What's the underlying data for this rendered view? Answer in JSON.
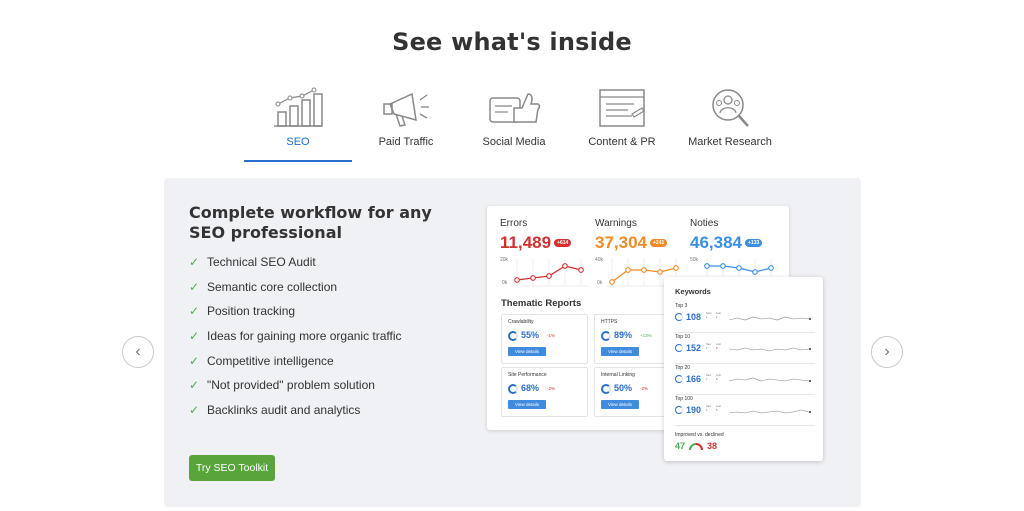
{
  "page": {
    "title": "See what's inside"
  },
  "tabs": [
    {
      "label": "SEO",
      "icon": "bar-chart-icon",
      "active": true
    },
    {
      "label": "Paid Traffic",
      "icon": "megaphone-icon",
      "active": false
    },
    {
      "label": "Social Media",
      "icon": "thumbs-up-icon",
      "active": false
    },
    {
      "label": "Content & PR",
      "icon": "document-window-icon",
      "active": false
    },
    {
      "label": "Market Research",
      "icon": "magnifier-people-icon",
      "active": false
    }
  ],
  "panel": {
    "title": "Complete workflow for any SEO professional",
    "features": [
      "Technical SEO Audit",
      "Semantic core collection",
      "Position tracking",
      "Ideas for gaining more organic traffic",
      "Competitive intelligence",
      "\"Not provided\" problem solution",
      "Backlinks audit and analytics"
    ],
    "cta_label": "Try SEO Toolkit"
  },
  "carousel": {
    "prev_icon": "chevron-left-icon",
    "next_icon": "chevron-right-icon"
  },
  "audit_card": {
    "stats": [
      {
        "name": "Errors",
        "value": "11,489",
        "badge": "+614",
        "color": "#d32f2f",
        "axis_top": "20k",
        "axis_bottom": "0k"
      },
      {
        "name": "Warnings",
        "value": "37,304",
        "badge": "+241",
        "color": "#f08a24",
        "axis_top": "40k",
        "axis_bottom": "0k"
      },
      {
        "name": "Noties",
        "value": "46,384",
        "badge": "+133",
        "color": "#3c8ee0",
        "axis_top": "50k",
        "axis_bottom": "0k"
      }
    ],
    "thematic_title": "Thematic Reports",
    "reports": [
      {
        "name": "Crawlability",
        "pct": "55%",
        "delta": "-1%",
        "delta_color": "#d32f2f",
        "button": "View details"
      },
      {
        "name": "HTTPS",
        "pct": "89%",
        "delta": "+13%",
        "delta_color": "#4caf50",
        "button": "View details"
      },
      {
        "name": "Site Performance",
        "pct": "68%",
        "delta": "-2%",
        "delta_color": "#d32f2f",
        "button": "View details"
      },
      {
        "name": "Internal Linking",
        "pct": "50%",
        "delta": "-2%",
        "delta_color": "#d32f2f",
        "button": "View details"
      }
    ]
  },
  "keywords_card": {
    "title": "Keywords",
    "rows": [
      {
        "name": "Top 3",
        "value": "108",
        "n1": "1",
        "n2": "1",
        "new": "New",
        "lost": "Lost"
      },
      {
        "name": "Top 10",
        "value": "152",
        "n1": "1",
        "n2": "8",
        "new": "New",
        "lost": "Lost"
      },
      {
        "name": "Top 20",
        "value": "166",
        "n1": "1",
        "n2": "8",
        "new": "New",
        "lost": "Lost"
      },
      {
        "name": "Top 100",
        "value": "190",
        "n1": "1",
        "n2": "5",
        "new": "New",
        "lost": "Lost"
      }
    ],
    "improved_label": "Improved vs. declined",
    "improved": "47",
    "declined": "38",
    "improved_color": "#4caf50",
    "declined_color": "#d32f2f"
  }
}
